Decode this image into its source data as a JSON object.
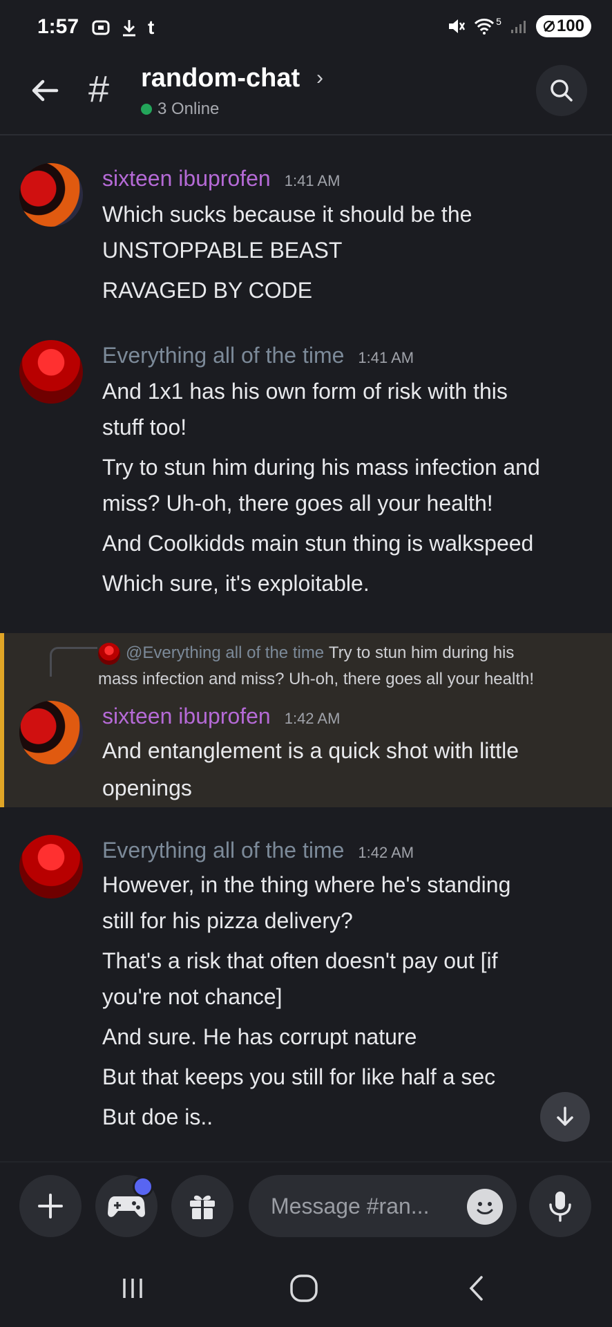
{
  "status_bar": {
    "time": "1:57",
    "left_glyph": "t",
    "battery": "100",
    "network": "5"
  },
  "header": {
    "channel": "random-chat",
    "online": "3 Online"
  },
  "messages": [
    {
      "author": "sixteen ibuprofen",
      "time": "1:41 AM",
      "lines": [
        "Which sucks because it should be the",
        "UNSTOPPABLE BEAST",
        "RAVAGED BY CODE"
      ]
    },
    {
      "author": "Everything all of the time",
      "time": "1:41 AM",
      "lines": [
        "And 1x1 has his own form of risk with this",
        "stuff too!",
        "Try to stun him during his mass infection and",
        "miss? Uh-oh, there goes all your health!",
        "And Coolkidds main stun thing is walkspeed",
        "Which sure, it's exploitable."
      ]
    },
    {
      "reply_name": "@Everything all of the time",
      "reply_text_1": "Try to stun him during his",
      "reply_text_2": "mass infection and miss? Uh-oh, there goes all your health!",
      "author": "sixteen ibuprofen",
      "time": "1:42 AM",
      "lines": [
        "And entanglement is a quick shot with little",
        "openings"
      ]
    },
    {
      "author": "Everything all of the time",
      "time": "1:42 AM",
      "lines": [
        "However, in the thing where he's standing",
        "still for his pizza delivery?",
        "That's a risk that often doesn't pay out [if",
        "you're not chance]",
        "And sure. He has corrupt nature",
        "But that keeps you still for like half a sec",
        "But doe is.."
      ]
    }
  ],
  "composer": {
    "placeholder": "Message #ran..."
  },
  "colors": {
    "accent": "#5865f2",
    "highlight_bar": "#e0a526",
    "online": "#23a55a",
    "author_purple": "#b56ad6",
    "author_grey": "#7c8a99"
  }
}
